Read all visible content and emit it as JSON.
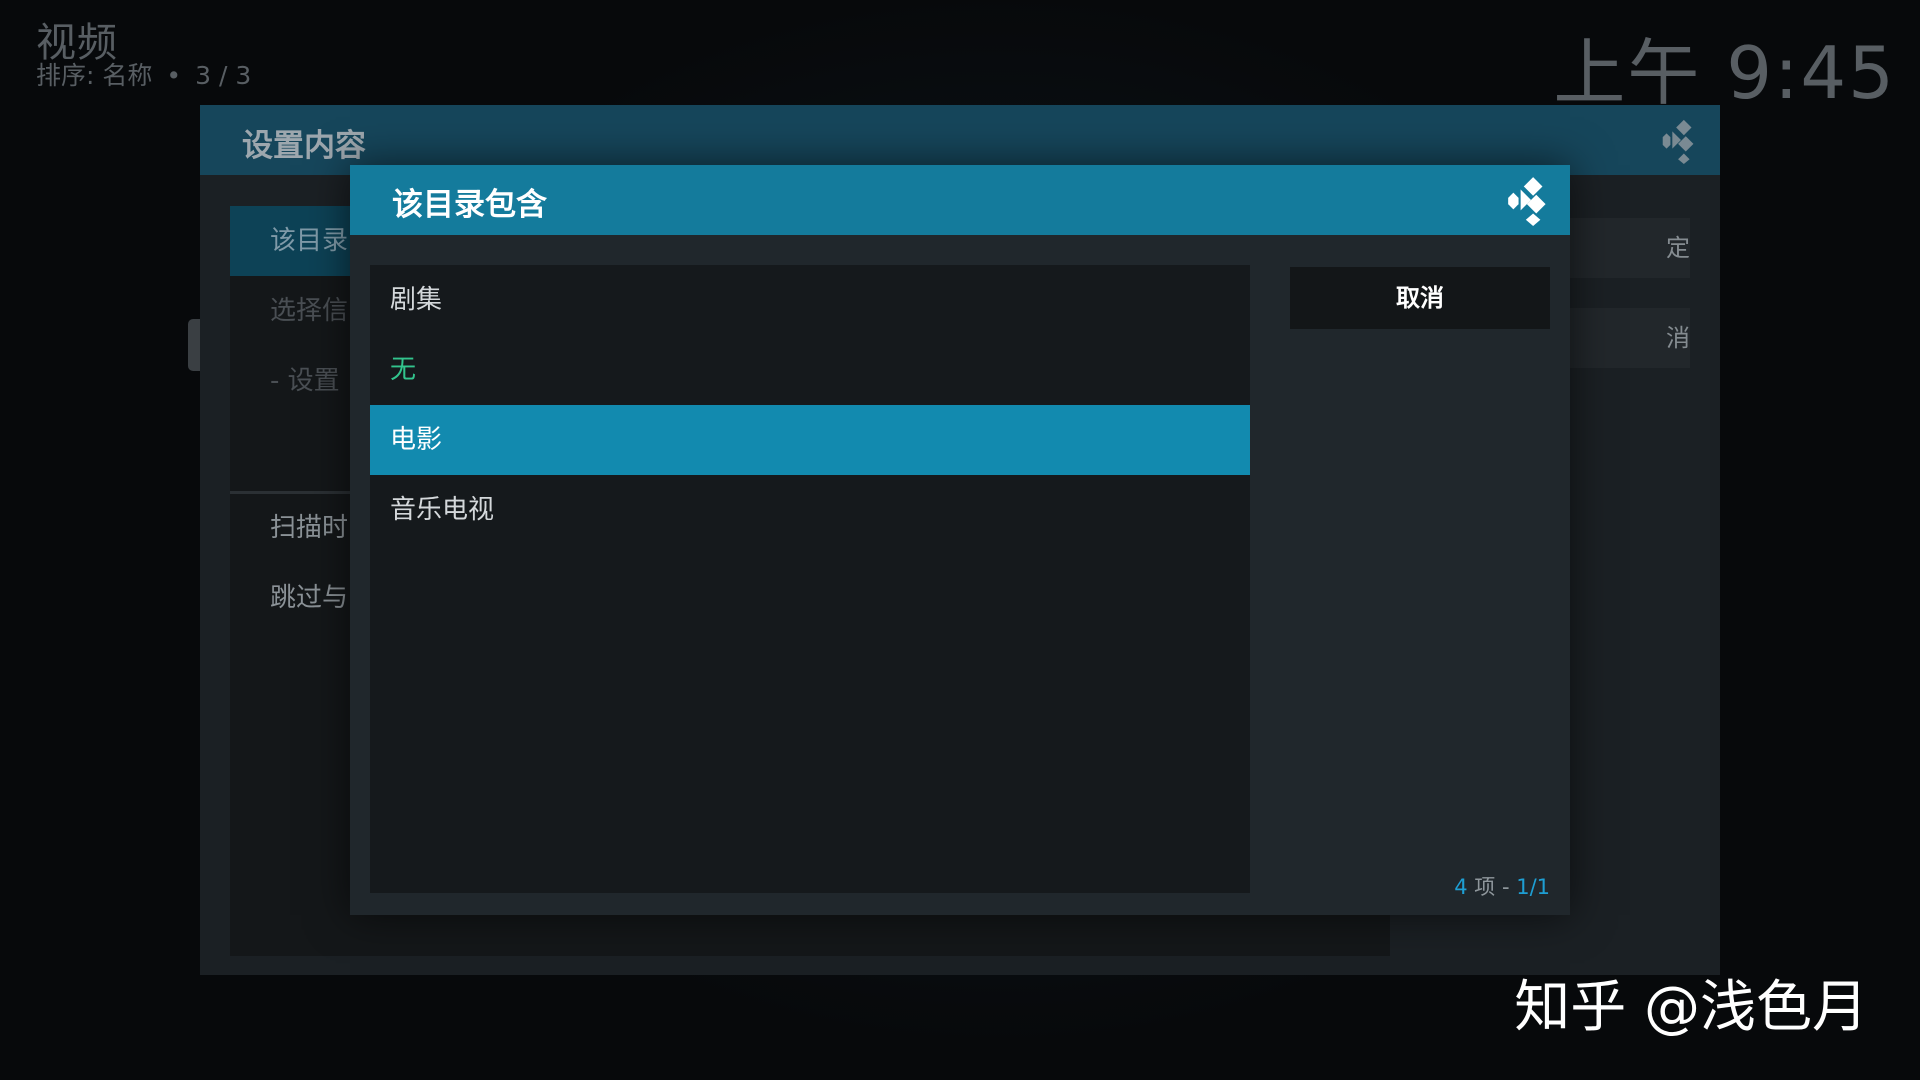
{
  "header": {
    "title": "视频",
    "sort_label": "排序: 名称",
    "separator": "•",
    "position": "3 / 3"
  },
  "clock": "上午 9:45",
  "back_window": {
    "title": "设置内容",
    "items": [
      {
        "label": "该目录"
      },
      {
        "label": "选择信"
      },
      {
        "label": "- 设置"
      },
      {
        "label": "扫描时"
      },
      {
        "label": "跳过与"
      }
    ],
    "buttons": [
      {
        "label": "定"
      },
      {
        "label": "消"
      }
    ]
  },
  "dialog": {
    "title": "该目录包含",
    "options": [
      {
        "label": "剧集"
      },
      {
        "label": "无"
      },
      {
        "label": "电影"
      },
      {
        "label": "音乐电视"
      }
    ],
    "selected_index": 2,
    "cancel_label": "取消",
    "count": {
      "num": "4",
      "unit": "项",
      "sep": "-",
      "page": "1/1"
    }
  },
  "watermark": "知乎 @浅色月",
  "colors": {
    "accent": "#147b9c",
    "selected": "#128aaf",
    "highlight_text": "#32c48d"
  }
}
